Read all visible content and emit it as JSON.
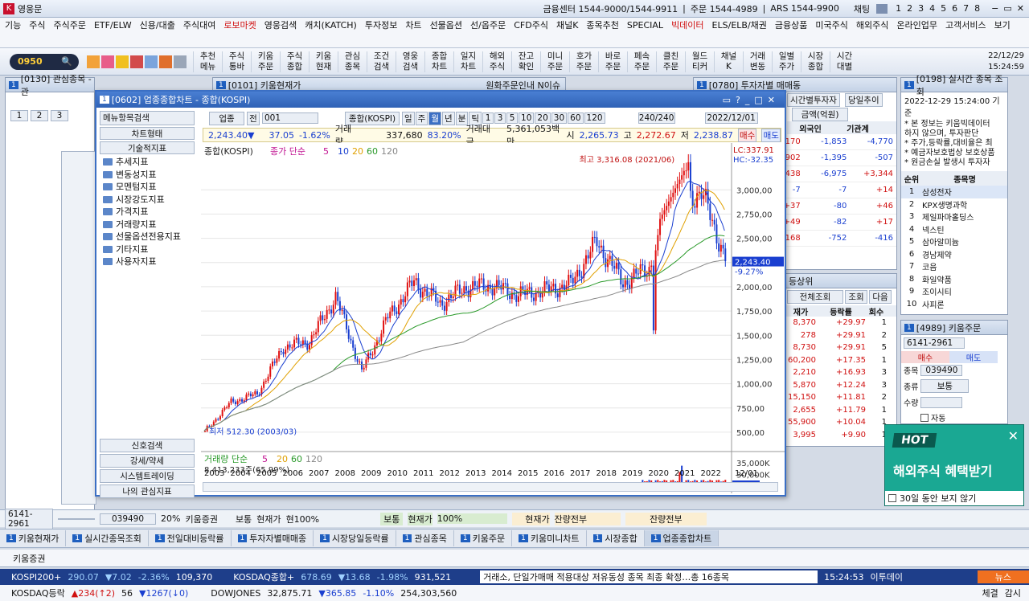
{
  "app": {
    "title": "영웅문",
    "center": "금융센터 1544-9000/1544-9911",
    "order": "주문 1544-4989",
    "ars": "ARS 1544-9900",
    "chat": "채팅",
    "pages": [
      "1",
      "2",
      "3",
      "4",
      "5",
      "6",
      "7",
      "8"
    ]
  },
  "menu": [
    "기능",
    "주식",
    "주식주문",
    "ETF/ELW",
    "신용/대출",
    "주식대여",
    "로보마켓",
    "영웅검색",
    "캐치(KATCH)",
    "투자정보",
    "차트",
    "선물옵션",
    "선/옵주문",
    "CFD주식",
    "채널K",
    "종목추천",
    "SPECIAL",
    "빅데이터",
    "ELS/ELB/채권",
    "금융상품",
    "미국주식",
    "해외주식",
    "온라인업무",
    "고객서비스",
    "보기"
  ],
  "toolbar": {
    "account": "0950",
    "buttons": [
      [
        "추천",
        "메뉴"
      ],
      [
        "주식",
        "통바"
      ],
      [
        "키움",
        "주문"
      ],
      [
        "주식",
        "종합"
      ],
      [
        "키움",
        "현재"
      ],
      [
        "관심",
        "종목"
      ],
      [
        "조건",
        "검색"
      ],
      [
        "영웅",
        "검색"
      ],
      [
        "종합",
        "차트"
      ],
      [
        "일지",
        "차트"
      ],
      [
        "해외",
        "주식"
      ],
      [
        "잔고",
        "확인"
      ],
      [
        "미니",
        "주문"
      ],
      [
        "호가",
        "주문"
      ],
      [
        "바로",
        "주문"
      ],
      [
        "페속",
        "주문"
      ],
      [
        "클친",
        "주문"
      ],
      [
        "월드",
        "티커"
      ],
      [
        "채널",
        "K"
      ],
      [
        "거래",
        "변동"
      ],
      [
        "일별",
        "주가"
      ],
      [
        "시장",
        "종합"
      ],
      [
        "시간",
        "대별"
      ]
    ],
    "date": "22/12/29",
    "time": "15:24:59"
  },
  "windows": {
    "watchlist": {
      "title": "[0130] 관심종목 - 관",
      "tabs": [
        "1",
        "2",
        "3"
      ]
    },
    "current": {
      "title": "[0101] 키움현재가",
      "info": "원화주문인내 N이슈"
    },
    "investor": {
      "title": "[0780] 투자자별 매매동",
      "tabs": [
        "시간별투자자",
        "당일추이"
      ],
      "select": "금액(억원)",
      "col1": "외국인",
      "col2": "기관계",
      "rows": [
        [
          "5,170",
          "-1,853",
          "-4,770"
        ],
        [
          "3,902",
          "-1,395",
          "-507"
        ],
        [
          "2,438",
          "-6,975",
          "+3,344"
        ],
        [
          "-7",
          "-7",
          "+14"
        ],
        [
          "+37",
          "-80",
          "+46"
        ],
        [
          "+49",
          "-82",
          "+17"
        ],
        [
          "1,168",
          "-752",
          "-416"
        ]
      ]
    },
    "realtime": {
      "title": "[0198] 실시간 종목 조회",
      "date": "2022-12-29 15:24:00 기준",
      "notice": [
        "* 본 정보는 키움빅데이터",
        "하지 않으며, 투자판단",
        "* 주가,등락률,대비율은 최",
        "* 예금자보호법상 보호상품",
        "* 원금손실 발생시 투자자"
      ],
      "col_rank": "순위",
      "col_name": "종목명",
      "items": [
        "삼성전자",
        "KPX생명과학",
        "제일파마홀딩스",
        "넥스틴",
        "삼아알미늄",
        "경남제약",
        "코음",
        "화일약품",
        "조이시티",
        "사피론"
      ]
    },
    "rising": {
      "title": "등상위",
      "select": "전체조회",
      "btn1": "조회",
      "btn2": "다음",
      "cols": [
        "재가",
        "등락률",
        "회수"
      ],
      "rows": [
        [
          "8,370",
          "+29.97",
          "1"
        ],
        [
          "278",
          "+29.91",
          "2"
        ],
        [
          "8,730",
          "+29.91",
          "5"
        ],
        [
          "60,200",
          "+17.35",
          "1"
        ],
        [
          "2,210",
          "+16.93",
          "3"
        ],
        [
          "5,870",
          "+12.24",
          "3"
        ],
        [
          "15,150",
          "+11.81",
          "2"
        ],
        [
          "2,655",
          "+11.79",
          "1"
        ],
        [
          "55,900",
          "+10.04",
          "1"
        ],
        [
          "3,995",
          "+9.90",
          "1"
        ]
      ]
    },
    "order": {
      "title": "[4989] 키움주문",
      "account": "6141-2961",
      "buy": "매수",
      "sell": "매도",
      "code": "039490",
      "kind": "보통",
      "label_code": "종목",
      "label_kind": "종류",
      "label_qty": "수량",
      "auto": "자동"
    }
  },
  "chart": {
    "title": "[0602] 업종종합차트 - 종합(KOSPI)",
    "search": "메뉴항목검색",
    "sector": "업종",
    "all": "전",
    "code": "001",
    "name": "종합(KOSPI)",
    "periods": [
      "일",
      "주",
      "월",
      "년",
      "분",
      "틱",
      "1",
      "3",
      "5",
      "10",
      "20",
      "30",
      "60",
      "120"
    ],
    "count": "240/240",
    "end_date": "2022/12/01",
    "price": "2,243.40▼",
    "change": "37.05",
    "pct": "-1.62%",
    "vol_label": "거래량",
    "volume": "337,680",
    "vol_pct": "83.20%",
    "amt_label": "거래대금",
    "amount": "5,361,053백만",
    "open_label": "시",
    "open": "2,265.73",
    "high_label": "고",
    "high": "2,272.67",
    "low_label": "저",
    "low": "2,238.87",
    "buy": "매수",
    "sell": "매도",
    "left_head1": "차트형태",
    "left_head2": "기술적지표",
    "folders": [
      "추세지표",
      "변동성지표",
      "모멘텀지표",
      "시장강도지표",
      "가격지표",
      "거래량지표",
      "선물옵션전용지표",
      "기타지표",
      "사용자지표"
    ],
    "left_bottom": [
      "신호검색",
      "강세/약세",
      "시스템트레이딩",
      "나의 관심지표"
    ],
    "legend_price": "종합(KOSPI)",
    "legend_ma": "종가 단순",
    "ma_periods": [
      "5",
      "10",
      "20",
      "60",
      "120"
    ],
    "legend_vol": "거래량 단순",
    "vol_periods": [
      "5",
      "20",
      "60",
      "120"
    ],
    "vol_value": "8,413,233주(65.99%)",
    "max_label": "최고 3,316.08 (2021/06)",
    "min_label": "최저 512.30 (2003/03)",
    "lc": "LC:337.91",
    "hc": "HC:-32.35",
    "cur_tag": "2,243.40",
    "cur_pct": "-9.27%",
    "vol_tag": "8,413K",
    "vol_tag_pct": "65.99%",
    "last_axis": "12/01",
    "y_ticks": [
      "3,000,00",
      "2,750,00",
      "2,500,00",
      "2,250,00",
      "2,000,00",
      "1,750,00",
      "1,500,00",
      "1,250,00",
      "1,000,00",
      "750,00",
      "500,00"
    ],
    "vol_ticks": [
      "35,000K",
      "30,000K",
      "25,000K",
      "20,000K",
      "15,000K",
      "10,000K",
      "5,000K"
    ],
    "years": [
      "2003",
      "2004",
      "2005",
      "2006",
      "2007",
      "2008",
      "2009",
      "2010",
      "2011",
      "2012",
      "2013",
      "2014",
      "2015",
      "2016",
      "2017",
      "2018",
      "2019",
      "2020",
      "2021",
      "2022"
    ]
  },
  "chart_data": {
    "type": "candlestick",
    "title": "종합(KOSPI) 월봉",
    "xlabel": "",
    "ylabel": "",
    "x": [
      2003,
      2004,
      2005,
      2006,
      2007,
      2008,
      2009,
      2010,
      2011,
      2012,
      2013,
      2014,
      2015,
      2016,
      2017,
      2018,
      2019,
      2020,
      2021,
      2022
    ],
    "close": [
      810,
      895,
      1379,
      1434,
      1897,
      1124,
      1683,
      2051,
      1826,
      1997,
      2011,
      1916,
      1961,
      2026,
      2467,
      2041,
      2198,
      2873,
      2978,
      2236
    ],
    "ylim": [
      400,
      3400
    ],
    "max": 3316.08,
    "min": 512.3
  },
  "bottom": {
    "account": "6141-2961",
    "code": "039490",
    "margin": "20%",
    "mkt": "키움증권",
    "f1": "보통",
    "f2": "현재가",
    "f3": "현100%",
    "f4": "보통",
    "f5": "현재가",
    "f6": "100%",
    "f7": "현재가",
    "f8": "잔량전부",
    "f9": "잔량전부",
    "tabs": [
      "키움현재가",
      "실시간종목조회",
      "전일대비등락률",
      "투자자별매매종",
      "시장당일등락률",
      "관심종목",
      "키움주문",
      "키움미니차트",
      "시장종합",
      "업종종합차트"
    ],
    "company": "키움증권"
  },
  "ticker": {
    "r1": [
      "KOSPI200+",
      "290.07",
      "▼7.02",
      "-2.36%",
      "109,370",
      "KOSDAQ종합+",
      "678.69",
      "▼13.68",
      "-1.98%",
      "931,521"
    ],
    "news": "거래소, 단일가매매 적용대상 저유동성 종목 최종 확정…총 16종목",
    "news_time": "15:24:53",
    "news_src": "이투데이",
    "news_btn": "뉴스",
    "r2": [
      "KOSDAQ등락",
      "▲234(↑2)",
      "56",
      "▼1267(↓0)",
      "DOWJONES",
      "32,875.71",
      "▼365.85",
      "-1.10%",
      "254,303,560"
    ],
    "r2b": [
      "체결",
      "감시"
    ]
  },
  "popup": {
    "badge": "HOT",
    "text": "해외주식 혜택받기",
    "check": "30일 동안 보지 않기"
  }
}
